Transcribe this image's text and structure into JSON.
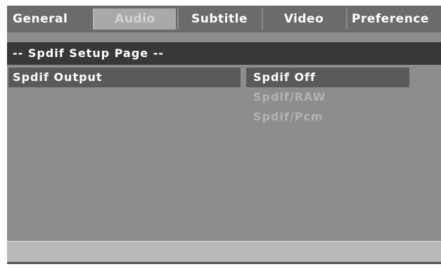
{
  "tabs": [
    {
      "label": "General"
    },
    {
      "label": "Audio"
    },
    {
      "label": "Subtitle"
    },
    {
      "label": "Video"
    },
    {
      "label": "Preference"
    }
  ],
  "active_tab": "Audio",
  "page": {
    "header": "-- Spdif Setup Page --"
  },
  "setting": {
    "label": "Spdif Output"
  },
  "options": [
    {
      "label": "Spdif Off",
      "state": "selected"
    },
    {
      "label": "Spdif/RAW",
      "state": "disabled"
    },
    {
      "label": "Spdif/Pcm",
      "state": "disabled"
    }
  ],
  "colors": {
    "screen_background": "#8d8d8d",
    "tabbar_background": "#6b6b6b",
    "active_tab_background": "#a9a9a9",
    "header_background": "#383838",
    "highlight_background": "#5a5a5a",
    "text_primary": "#ffffff",
    "text_disabled": "#b2b2b2",
    "footer_background": "#b9b9b9"
  }
}
